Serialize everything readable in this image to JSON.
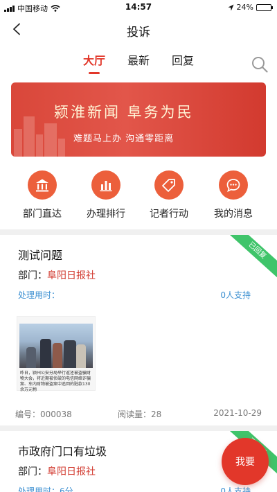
{
  "status_bar": {
    "carrier": "中国移动",
    "time": "14:57",
    "battery_text": "24%",
    "battery_level": 0.24
  },
  "nav": {
    "title": "投诉",
    "back_icon": "chevron-left-icon"
  },
  "tabs": [
    {
      "label": "大厅",
      "active": true
    },
    {
      "label": "最新",
      "active": false
    },
    {
      "label": "回复",
      "active": false
    }
  ],
  "search_icon": "search-icon",
  "banner": {
    "title": "颍淮新闻  阜务为民",
    "subtitle": "难题马上办   沟通零距离"
  },
  "quick_menu": [
    {
      "label": "部门直达",
      "icon": "building-icon"
    },
    {
      "label": "办理排行",
      "icon": "bar-chart-icon"
    },
    {
      "label": "记者行动",
      "icon": "tag-icon"
    },
    {
      "label": "我的消息",
      "icon": "message-icon"
    }
  ],
  "cards": [
    {
      "status": "已回复",
      "title": "测试问题",
      "dept_label": "部门：",
      "dept": "阜阳日报社",
      "time_label": "处理用时：",
      "support": "0人支持",
      "image_caption": "昨日，颍州公安分局举行返还被盗骗财物大会，将近期被侦破的电信网络诈骗案、车内财物被盗案中追回的赃款130余万元物",
      "id_label": "编号：000038",
      "reads_label": "阅读量：28",
      "date": "2021-10-29"
    },
    {
      "status": "已回复",
      "title": "市政府门口有垃圾",
      "dept_label": "部门：",
      "dept": "阜阳日报社",
      "time_label": "处理用时：6分",
      "support": "0人支持"
    }
  ],
  "fab": {
    "label": "我要"
  },
  "colors": {
    "accent": "#e2372a",
    "icon_circle": "#ec5f3b",
    "link_blue": "#3b8fd1",
    "status_green": "#3fc46a"
  }
}
